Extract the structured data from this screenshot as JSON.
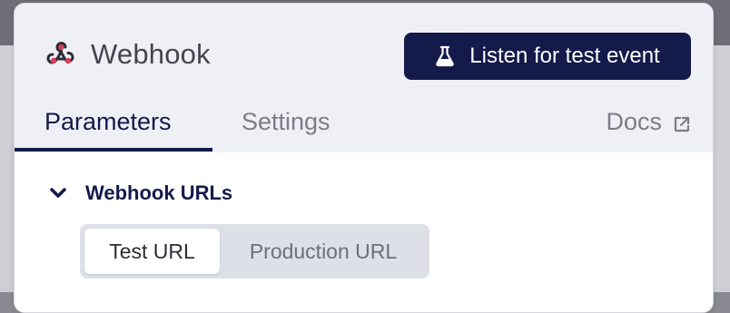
{
  "node": {
    "title": "Webhook",
    "icon": "webhook-icon",
    "icon_color": "#d93c5c"
  },
  "header": {
    "listen_button_label": "Listen for test event",
    "listen_button_icon": "flask-icon",
    "accent_color": "#141a4a"
  },
  "tabs": [
    {
      "label": "Parameters",
      "active": true
    },
    {
      "label": "Settings",
      "active": false
    }
  ],
  "docs": {
    "label": "Docs",
    "icon": "external-link-icon"
  },
  "section": {
    "title": "Webhook URLs",
    "icon": "chevron-down-icon",
    "expanded": true
  },
  "url_toggle": {
    "options": [
      "Test URL",
      "Production URL"
    ],
    "selected": "Test URL"
  }
}
